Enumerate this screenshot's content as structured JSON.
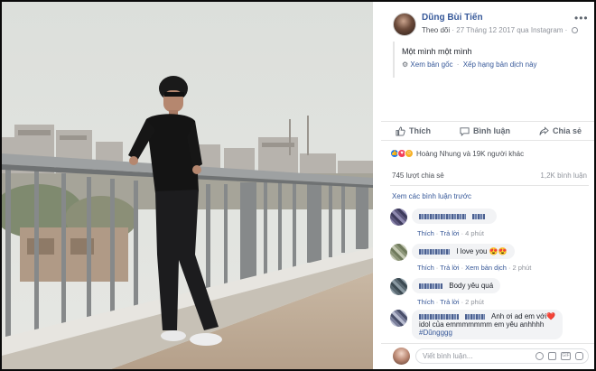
{
  "post": {
    "author": "Dũng Bùi Tiến",
    "follow": "Theo dõi",
    "meta": "· 27 Tháng 12 2017 qua Instagram ·",
    "more_icon": "ellipsis-icon",
    "caption": "Một mình một mình",
    "see_original": "Xem bản gốc",
    "rate_translation": "Xếp hạng bản dịch này"
  },
  "actions": [
    {
      "label": "Thích",
      "icon": "like-icon"
    },
    {
      "label": "Bình luận",
      "icon": "comment-icon"
    },
    {
      "label": "Chia sẻ",
      "icon": "share-icon"
    }
  ],
  "reactions": {
    "icons": [
      "like",
      "love",
      "haha"
    ],
    "text": "Hoàng Nhung và 19K người khác"
  },
  "counts": {
    "shares": "745 lượt chia sẻ",
    "comments": "1,2K bình luận"
  },
  "view_previous": "Xem các bình luận trước",
  "comments": [
    {
      "text": "",
      "actions": [
        "Thích",
        "Trả lời"
      ],
      "time": "4 phút"
    },
    {
      "text": "I love you 😍😍",
      "actions": [
        "Thích",
        "Trả lời",
        "Xem bản dịch"
      ],
      "time": "2 phút"
    },
    {
      "text": "Body yêu quá",
      "actions": [
        "Thích",
        "Trả lời"
      ],
      "time": "2 phút"
    },
    {
      "text": "Anh ơi ad em với❤️",
      "text2": "idol của emmmmmmm em yêu anhhhh",
      "text3": "#Dũngggg",
      "actions": [],
      "time": ""
    }
  ],
  "composer": {
    "placeholder": "Viết bình luận..."
  },
  "colors": {
    "link": "#365899",
    "muted": "#90949c",
    "bubble": "#f2f3f5",
    "like": "#1877f2"
  }
}
